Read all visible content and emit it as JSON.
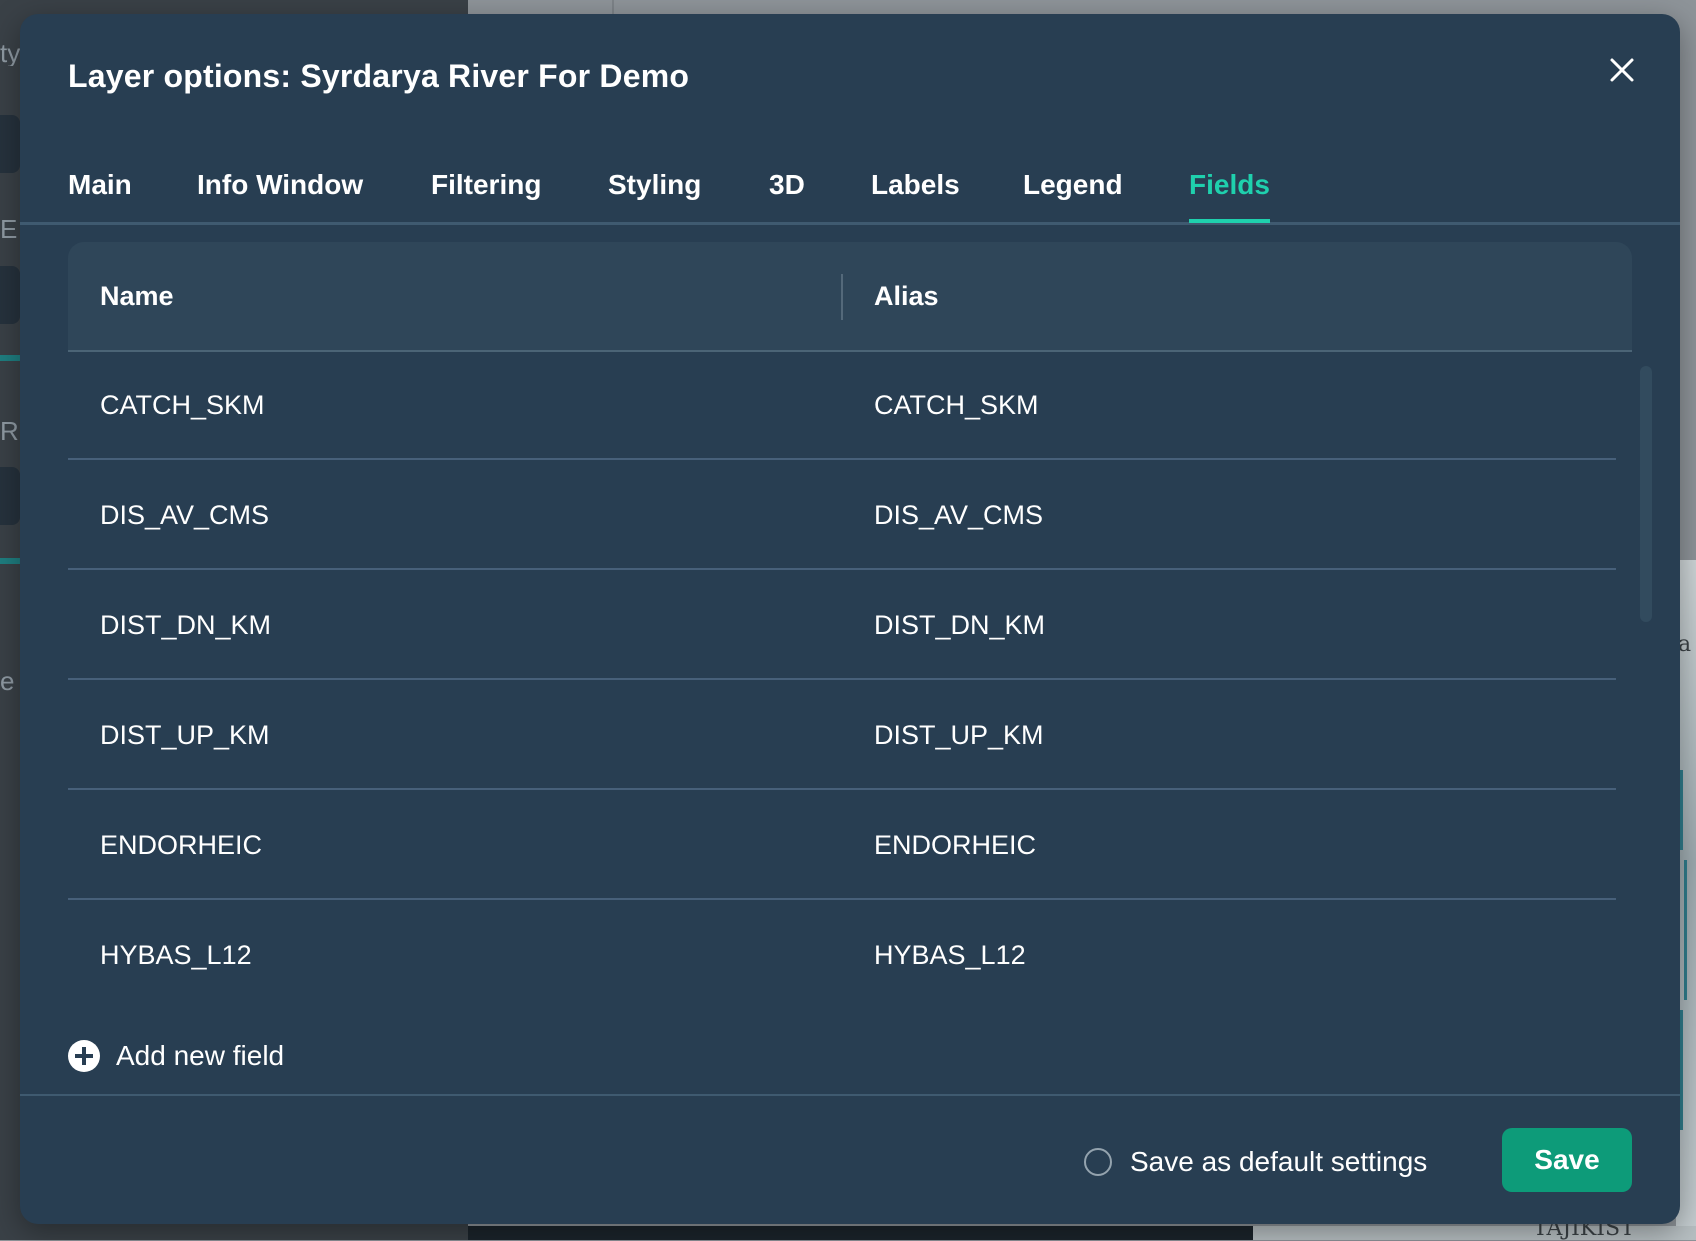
{
  "background": {
    "left_ghost_texts": [
      "ty",
      "E N",
      "R I",
      "e"
    ],
    "map_ghost_texts": [
      "a",
      "TAJIKIST"
    ]
  },
  "modal": {
    "title": "Layer options: Syrdarya River For Demo",
    "close_icon": "close-icon",
    "tabs": [
      {
        "label": "Main",
        "active": false
      },
      {
        "label": "Info Window",
        "active": false
      },
      {
        "label": "Filtering",
        "active": false
      },
      {
        "label": "Styling",
        "active": false
      },
      {
        "label": "3D",
        "active": false
      },
      {
        "label": "Labels",
        "active": false
      },
      {
        "label": "Legend",
        "active": false
      },
      {
        "label": "Fields",
        "active": true
      }
    ],
    "table": {
      "columns": [
        "Name",
        "Alias"
      ],
      "rows": [
        {
          "name": "CATCH_SKM",
          "alias": "CATCH_SKM"
        },
        {
          "name": "DIS_AV_CMS",
          "alias": "DIS_AV_CMS"
        },
        {
          "name": "DIST_DN_KM",
          "alias": "DIST_DN_KM"
        },
        {
          "name": "DIST_UP_KM",
          "alias": "DIST_UP_KM"
        },
        {
          "name": "ENDORHEIC",
          "alias": "ENDORHEIC"
        },
        {
          "name": "HYBAS_L12",
          "alias": "HYBAS_L12"
        }
      ]
    },
    "add_field": {
      "label": "Add new field",
      "icon": "plus-circle-icon"
    },
    "footer": {
      "default_checkbox_label": "Save as default settings",
      "default_checked": false,
      "save_label": "Save"
    }
  },
  "colors": {
    "modal_bg": "#283e52",
    "accent_active_tab": "#1fd0ad",
    "save_button": "#0d9b79"
  }
}
